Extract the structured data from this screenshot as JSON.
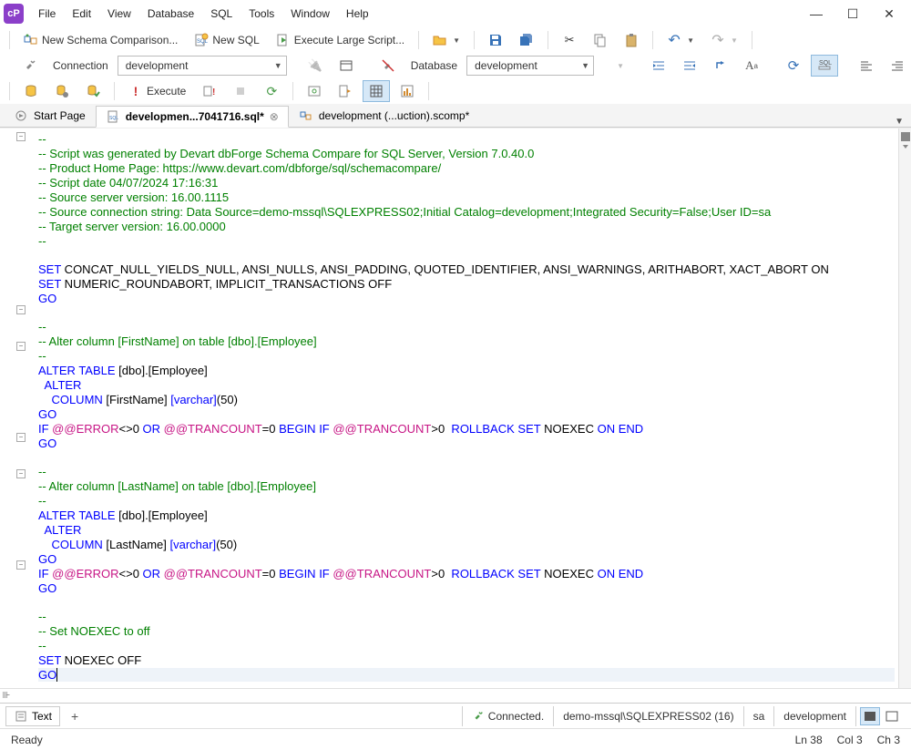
{
  "menu": [
    "File",
    "Edit",
    "View",
    "Database",
    "SQL",
    "Tools",
    "Window",
    "Help"
  ],
  "toolbar1": {
    "newSchema": "New Schema Comparison...",
    "newSQL": "New SQL",
    "executeLarge": "Execute Large Script..."
  },
  "toolbar2": {
    "connectionLabel": "Connection",
    "connectionValue": "development",
    "databaseLabel": "Database",
    "databaseValue": "development"
  },
  "toolbar3": {
    "execute": "Execute"
  },
  "tabs": {
    "startPage": "Start Page",
    "activeTab": "developmen...7041716.sql*",
    "compareTab": "development (...uction).scomp*"
  },
  "code": {
    "l1": "--",
    "l2": "-- Script was generated by Devart dbForge Schema Compare for SQL Server, Version 7.0.40.0",
    "l3": "-- Product Home Page: https://www.devart.com/dbforge/sql/schemacompare/",
    "l4": "-- Script date 04/07/2024 17:16:31",
    "l5": "-- Source server version: 16.00.1115",
    "l6": "-- Source connection string: Data Source=demo-mssql\\SQLEXPRESS02;Initial Catalog=development;Integrated Security=False;User ID=sa",
    "l7": "-- Target server version: 16.00.0000",
    "l8": "--",
    "set1a": "SET",
    "set1b": " CONCAT_NULL_YIELDS_NULL, ANSI_NULLS, ANSI_PADDING, QUOTED_IDENTIFIER, ANSI_WARNINGS, ARITHABORT, XACT_ABORT ON",
    "set2a": "SET",
    "set2b": " NUMERIC_ROUNDABORT, IMPLICIT_TRANSACTIONS OFF",
    "go": "GO",
    "alt1a": "--",
    "alt1b": "-- Alter column [FirstName] on table [dbo].[Employee]",
    "alt1c": "--",
    "alter1": "ALTER",
    "table1": " TABLE",
    "tbl1": " [dbo].[Employee]",
    "alter2": "  ALTER",
    "col": "    COLUMN",
    "fn": " [FirstName] ",
    "vc": "[varchar]",
    "fifty": "(50)",
    "if": "IF",
    "err": " @@ERROR",
    "neq": "<>",
    "zero": "0 ",
    "or": "OR",
    "tc": " @@TRANCOUNT",
    "eq": "=",
    "begin": "BEGIN",
    "if2": " IF",
    "gt": ">",
    "rb": " ROLLBACK",
    "setnx": " SET",
    "noexec": " NOEXEC ",
    "on": "ON",
    "end": " END",
    "alt2b": "-- Alter column [LastName] on table [dbo].[Employee]",
    "ln": " [LastName] ",
    "setnxcomment": "-- Set NOEXEC to off",
    "setk": "SET",
    "noexecoff": " NOEXEC OFF"
  },
  "bottomTabs": {
    "text": "Text"
  },
  "connection": {
    "status": "Connected.",
    "server": "demo-mssql\\SQLEXPRESS02 (16)",
    "user": "sa",
    "db": "development"
  },
  "statusbar": {
    "ready": "Ready",
    "ln": "Ln 38",
    "col": "Col 3",
    "ch": "Ch 3"
  }
}
